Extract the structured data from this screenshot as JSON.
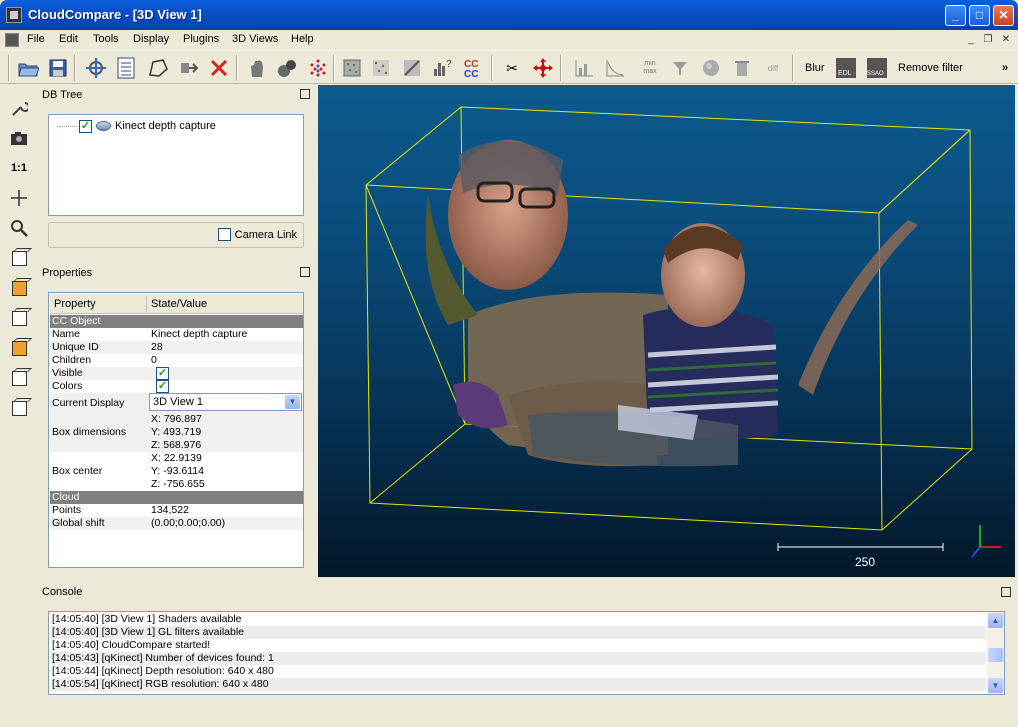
{
  "window": {
    "title": "CloudCompare - [3D View 1]"
  },
  "menu": [
    "File",
    "Edit",
    "Tools",
    "Display",
    "Plugins",
    "3D Views",
    "Help"
  ],
  "toolbar": {
    "blur_label": "Blur",
    "remove_filter_label": "Remove filter",
    "cc_label": "CC",
    "minmax_label": "min max"
  },
  "vtoolbar": {
    "one_to_one": "1:1"
  },
  "db_tree": {
    "title": "DB Tree",
    "items": [
      {
        "label": "Kinect depth capture",
        "checked": true
      }
    ],
    "camera_link_label": "Camera Link"
  },
  "properties": {
    "title": "Properties",
    "col_property": "Property",
    "col_value": "State/Value",
    "cc_object_header": "CC Object",
    "name_key": "Name",
    "name_value": "Kinect depth capture",
    "uid_key": "Unique ID",
    "uid_value": "28",
    "children_key": "Children",
    "children_value": "0",
    "visible_key": "Visible",
    "colors_key": "Colors",
    "display_key": "Current Display",
    "display_value": "3D View 1",
    "box_dim_key": "Box dimensions",
    "box_dim_x": "X: 796.897",
    "box_dim_y": "Y: 493.719",
    "box_dim_z": "Z: 568.976",
    "box_center_key": "Box center",
    "box_center_x": "X: 22.9139",
    "box_center_y": "Y: -93.6114",
    "box_center_z": "Z: -756.655",
    "cloud_header": "Cloud",
    "points_key": "Points",
    "points_value": "134,522",
    "shift_key": "Global shift",
    "shift_value": "(0.00;0.00;0.00)"
  },
  "view": {
    "scale_label": "250",
    "colors": {
      "bbox": "#e6e600",
      "bg_top": "#0d5a8c",
      "bg_bottom": "#03172a"
    }
  },
  "console": {
    "title": "Console",
    "lines": [
      "[14:05:40] [3D View 1] Shaders available",
      "[14:05:40] [3D View 1] GL filters available",
      "[14:05:40] CloudCompare started!",
      "[14:05:43] [qKinect] Number of devices found: 1",
      "[14:05:44] [qKinect] Depth resolution: 640 x 480",
      "[14:05:54] [qKinect] RGB resolution: 640 x 480"
    ]
  }
}
